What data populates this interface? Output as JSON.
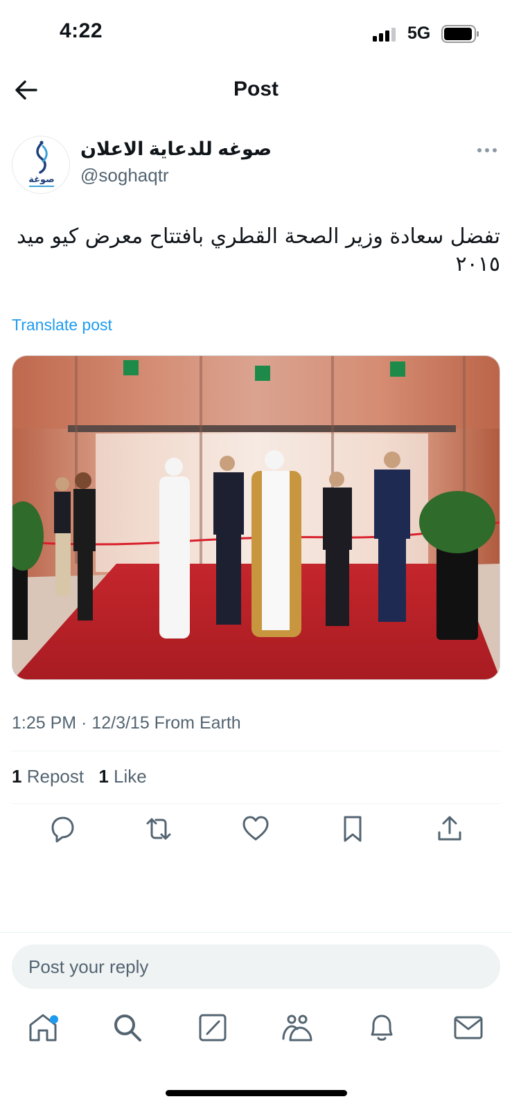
{
  "status_bar": {
    "time": "4:22",
    "network": "5G"
  },
  "header": {
    "title": "Post"
  },
  "author": {
    "name": "صوغه للدعاية الاعلان",
    "handle": "@soghaqtr",
    "avatar_logo_text": "صوغة"
  },
  "tweet": {
    "text": "تفضل سعادة وزير الصحة القطري بافتتاح  معرض كيو ميد ٢٠١٥",
    "translate_label": "Translate post",
    "meta": "1:25 PM · 12/3/15 From Earth"
  },
  "stats": {
    "reposts_count": "1",
    "reposts_label": "Repost",
    "likes_count": "1",
    "likes_label": "Like"
  },
  "reply": {
    "placeholder": "Post your reply"
  },
  "icons": {
    "back": "arrow-left-icon",
    "more": "more-dots-icon",
    "reply": "reply-icon",
    "repost": "repost-icon",
    "like": "heart-icon",
    "bookmark": "bookmark-icon",
    "share": "share-icon",
    "home": "home-icon",
    "search": "search-icon",
    "compose": "compose-icon",
    "communities": "communities-icon",
    "notifications": "bell-icon",
    "messages": "mail-icon"
  },
  "colors": {
    "accent": "#1d9bf0",
    "secondary_text": "#536471",
    "text": "#0f1419",
    "divider": "#eff3f4"
  }
}
